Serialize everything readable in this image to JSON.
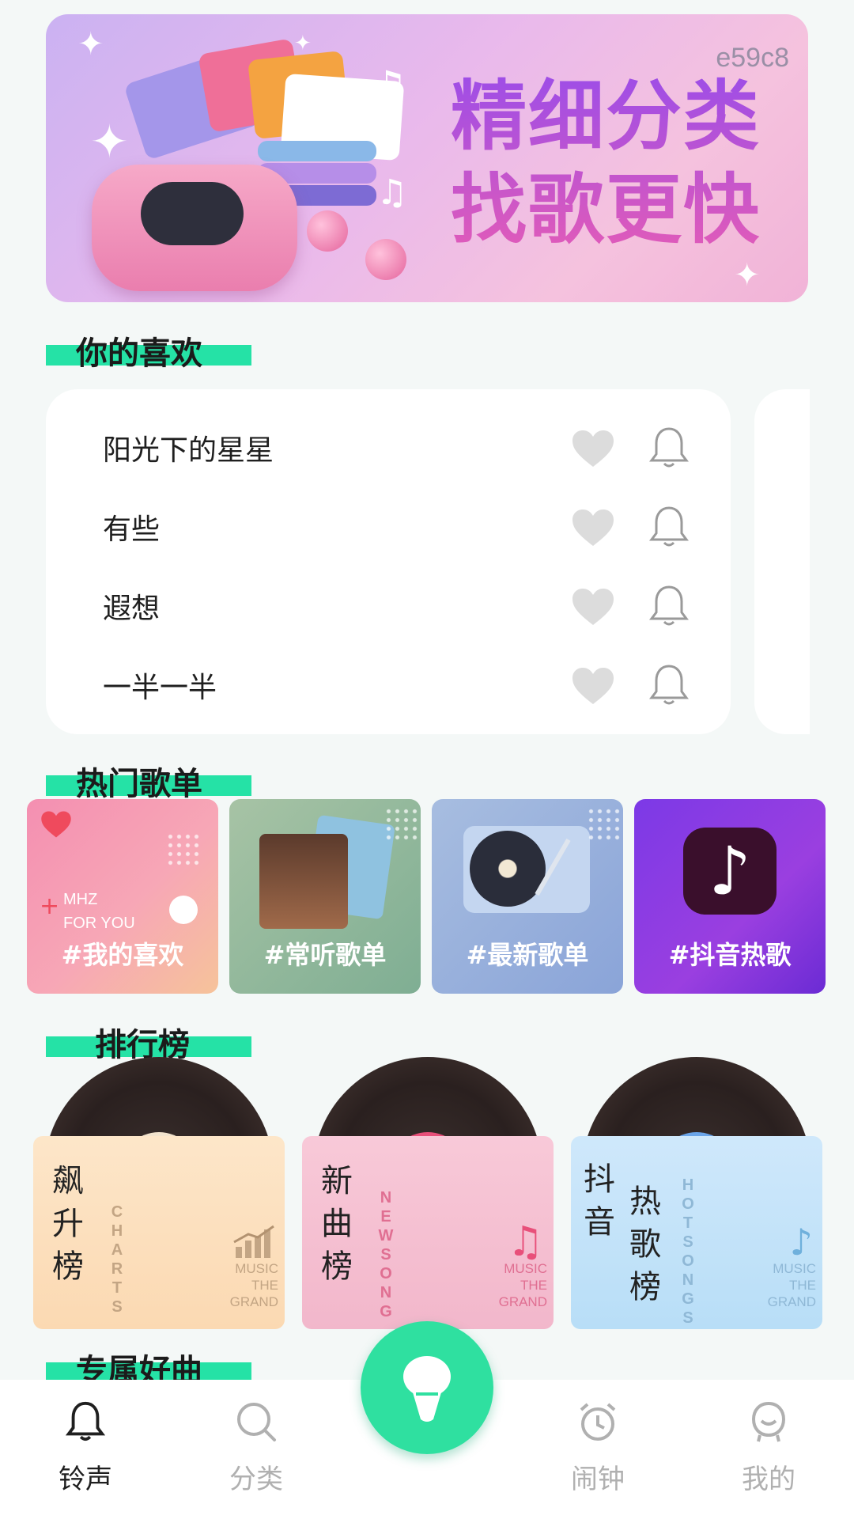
{
  "banner": {
    "code": "e59c8",
    "headline_line1": "精细分类",
    "headline_line2": "找歌更快"
  },
  "sections": {
    "favorites": "你的喜欢",
    "hot_playlists": "热门歌单",
    "rankings": "排行榜",
    "exclusive": "专属好曲"
  },
  "favorites": [
    {
      "name": "阳光下的星星"
    },
    {
      "name": "有些"
    },
    {
      "name": "遐想"
    },
    {
      "name": "一半一半"
    }
  ],
  "playlists": [
    {
      "label": "#我的喜欢",
      "badge_line1": "MHZ",
      "badge_line2": "FOR YOU"
    },
    {
      "label": "#常听歌单"
    },
    {
      "label": "#最新歌单"
    },
    {
      "label": "#抖音热歌"
    }
  ],
  "rankings": [
    {
      "title_chars": [
        "飙",
        "升",
        "榜"
      ],
      "side_text": [
        "C",
        "H",
        "A",
        "R",
        "T",
        "S"
      ],
      "grand": [
        "MUSIC",
        "THE",
        "GRAND"
      ]
    },
    {
      "title_chars": [
        "新",
        "曲",
        "榜"
      ],
      "side_text": [
        "N",
        "E",
        "W",
        "S",
        "O",
        "N",
        "G"
      ],
      "grand": [
        "MUSIC",
        "THE",
        "GRAND"
      ]
    },
    {
      "title_col1": [
        "抖",
        "音"
      ],
      "title_col2": [
        "热",
        "歌",
        "榜"
      ],
      "side_text": [
        "H",
        "O",
        "T",
        "S",
        "O",
        "N",
        "G",
        "S"
      ],
      "grand": [
        "MUSIC",
        "THE",
        "GRAND"
      ]
    }
  ],
  "bottom_nav": {
    "items": [
      {
        "label": "铃声",
        "icon": "bell-icon",
        "active": true
      },
      {
        "label": "分类",
        "icon": "search-icon",
        "active": false
      },
      {
        "label": "闹钟",
        "icon": "alarm-clock-icon",
        "active": false
      },
      {
        "label": "我的",
        "icon": "profile-icon",
        "active": false
      }
    ],
    "center_icon": "microphone-icon"
  },
  "colors": {
    "accent": "#25e2a6",
    "fab": "#2fe0a0",
    "background": "#f4f8f7"
  }
}
